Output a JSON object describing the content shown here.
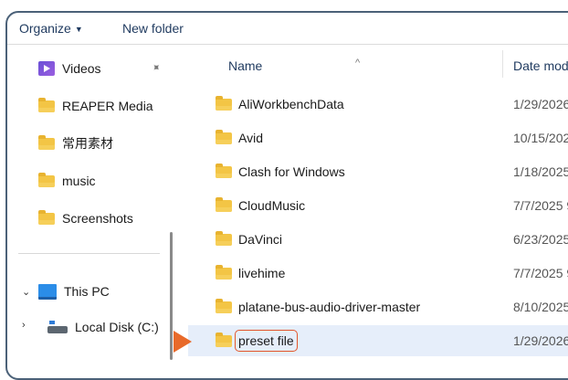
{
  "toolbar": {
    "organize_label": "Organize",
    "new_folder_label": "New folder"
  },
  "nav": {
    "items": [
      {
        "label": "Videos",
        "icon": "video-icon",
        "pinned": true
      },
      {
        "label": "REAPER Media",
        "icon": "folder-icon"
      },
      {
        "label": "常用素材",
        "icon": "folder-icon"
      },
      {
        "label": "music",
        "icon": "folder-icon"
      },
      {
        "label": "Screenshots",
        "icon": "folder-icon"
      }
    ],
    "this_pc_label": "This PC",
    "local_disk_label": "Local Disk (C:)"
  },
  "list": {
    "columns": {
      "name": "Name",
      "date": "Date mod"
    },
    "sort_indicator": "^",
    "rows": [
      {
        "name": "AliWorkbenchData",
        "date": "1/29/2026"
      },
      {
        "name": "Avid",
        "date": "10/15/202"
      },
      {
        "name": "Clash for Windows",
        "date": "1/18/2025"
      },
      {
        "name": "CloudMusic",
        "date": "7/7/2025 9"
      },
      {
        "name": "DaVinci",
        "date": "6/23/2025"
      },
      {
        "name": "livehime",
        "date": "7/7/2025 9"
      },
      {
        "name": "platane-bus-audio-driver-master",
        "date": "8/10/2025"
      },
      {
        "name": "preset file",
        "date": "1/29/2026",
        "selected": true
      }
    ]
  },
  "colors": {
    "accent": "#1f3a5f",
    "selection_bg": "#e6eefa",
    "highlight_outline": "#e2562b",
    "pointer": "#e86a2a",
    "folder": "#f3c545"
  }
}
